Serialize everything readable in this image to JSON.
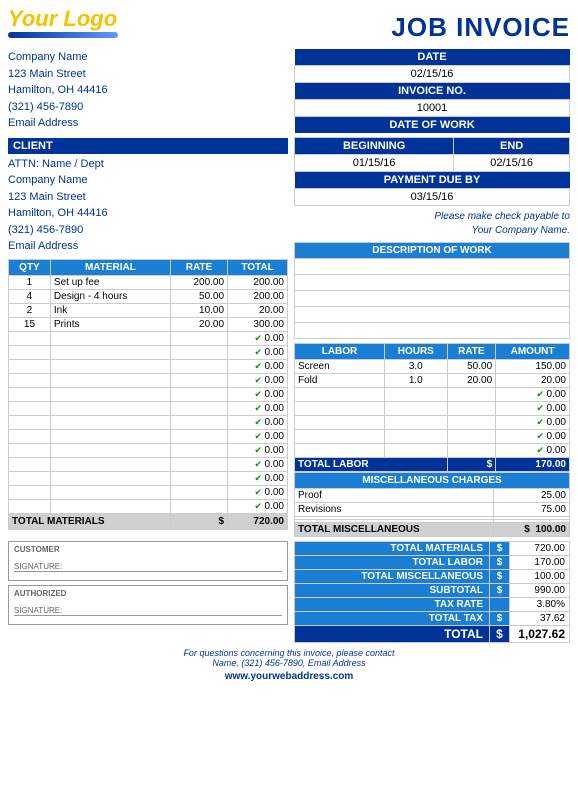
{
  "header": {
    "logo_text": "Your Logo",
    "invoice_title": "JOB INVOICE"
  },
  "sender": {
    "company": "Company Name",
    "address": "123 Main Street",
    "city": "Hamilton, OH  44416",
    "phone": "(321) 456-7890",
    "email": "Email Address"
  },
  "client_section": {
    "label": "CLIENT",
    "attn": "ATTN: Name / Dept",
    "company": "Company Name",
    "address": "123 Main Street",
    "city": "Hamilton, OH  44416",
    "phone": "(321) 456-7890",
    "email": "Email Address"
  },
  "date_info": {
    "date_label": "DATE",
    "date_value": "02/15/16",
    "invoice_label": "INVOICE NO.",
    "invoice_value": "10001",
    "date_of_work_label": "DATE OF WORK",
    "beginning_label": "BEGINNING",
    "beginning_value": "01/15/16",
    "end_label": "END",
    "end_value": "02/15/16",
    "payment_due_label": "PAYMENT DUE BY",
    "payment_due_value": "03/15/16",
    "payable_note_line1": "Please make check payable to",
    "payable_note_line2": "Your Company Name."
  },
  "materials": {
    "headers": [
      "QTY",
      "MATERIAL",
      "RATE",
      "TOTAL"
    ],
    "rows": [
      {
        "qty": "1",
        "material": "Set up fee",
        "rate": "200.00",
        "total": "200.00"
      },
      {
        "qty": "4",
        "material": "Design - 4 hours",
        "rate": "50.00",
        "total": "200.00"
      },
      {
        "qty": "2",
        "material": "Ink",
        "rate": "10.00",
        "total": "20.00"
      },
      {
        "qty": "15",
        "material": "Prints",
        "rate": "20.00",
        "total": "300.00"
      },
      {
        "qty": "",
        "material": "",
        "rate": "",
        "total": "0.00"
      },
      {
        "qty": "",
        "material": "",
        "rate": "",
        "total": "0.00"
      },
      {
        "qty": "",
        "material": "",
        "rate": "",
        "total": "0.00"
      },
      {
        "qty": "",
        "material": "",
        "rate": "",
        "total": "0.00"
      },
      {
        "qty": "",
        "material": "",
        "rate": "",
        "total": "0.00"
      },
      {
        "qty": "",
        "material": "",
        "rate": "",
        "total": "0.00"
      },
      {
        "qty": "",
        "material": "",
        "rate": "",
        "total": "0.00"
      },
      {
        "qty": "",
        "material": "",
        "rate": "",
        "total": "0.00"
      },
      {
        "qty": "",
        "material": "",
        "rate": "",
        "total": "0.00"
      },
      {
        "qty": "",
        "material": "",
        "rate": "",
        "total": "0.00"
      },
      {
        "qty": "",
        "material": "",
        "rate": "",
        "total": "0.00"
      },
      {
        "qty": "",
        "material": "",
        "rate": "",
        "total": "0.00"
      },
      {
        "qty": "",
        "material": "",
        "rate": "",
        "total": "0.00"
      }
    ],
    "total_label": "TOTAL MATERIALS",
    "total_dollar": "$",
    "total_value": "720.00"
  },
  "description": {
    "label": "DESCRIPTION OF WORK",
    "rows": [
      "",
      "",
      "",
      "",
      ""
    ]
  },
  "labor": {
    "headers": [
      "LABOR",
      "HOURS",
      "RATE",
      "AMOUNT"
    ],
    "rows": [
      {
        "labor": "Screen",
        "hours": "3.0",
        "rate": "50.00",
        "amount": "150.00"
      },
      {
        "labor": "Fold",
        "hours": "1.0",
        "rate": "20.00",
        "amount": "20.00"
      },
      {
        "labor": "",
        "hours": "",
        "rate": "",
        "amount": "0.00"
      },
      {
        "labor": "",
        "hours": "",
        "rate": "",
        "amount": "0.00"
      },
      {
        "labor": "",
        "hours": "",
        "rate": "",
        "amount": "0.00"
      },
      {
        "labor": "",
        "hours": "",
        "rate": "",
        "amount": "0.00"
      },
      {
        "labor": "",
        "hours": "",
        "rate": "",
        "amount": "0.00"
      }
    ],
    "total_label": "TOTAL LABOR",
    "total_dollar": "$",
    "total_value": "170.00"
  },
  "misc": {
    "label": "MISCELLANEOUS CHARGES",
    "rows": [
      {
        "description": "Proof",
        "amount": "25.00"
      },
      {
        "description": "Revisions",
        "amount": "75.00"
      },
      {
        "description": "",
        "amount": ""
      },
      {
        "description": "",
        "amount": ""
      }
    ],
    "total_label": "TOTAL MISCELLANEOUS",
    "total_dollar": "$",
    "total_value": "100.00"
  },
  "signatures": {
    "customer_label": "CUSTOMER",
    "customer_sig_label": "SIGNATURE:",
    "authorized_label": "AUTHORIZED",
    "authorized_sig_label": "SIGNATURE:"
  },
  "totals_summary": {
    "materials_label": "TOTAL MATERIALS",
    "materials_dollar": "$",
    "materials_value": "720.00",
    "labor_label": "TOTAL LABOR",
    "labor_dollar": "$",
    "labor_value": "170.00",
    "misc_label": "TOTAL MISCELLANEOUS",
    "misc_dollar": "$",
    "misc_value": "100.00",
    "subtotal_label": "SUBTOTAL",
    "subtotal_dollar": "$",
    "subtotal_value": "990.00",
    "tax_rate_label": "TAX RATE",
    "tax_rate_value": "3.80%",
    "total_tax_label": "TOTAL TAX",
    "total_tax_dollar": "$",
    "total_tax_value": "37.62",
    "total_label": "TOTAL",
    "total_dollar": "$",
    "total_value": "1,027.62"
  },
  "footer": {
    "note_line1": "For questions concerning this invoice, please contact",
    "note_line2": "Name, (321) 456-7890, Email Address",
    "website": "www.yourwebaddress.com"
  }
}
